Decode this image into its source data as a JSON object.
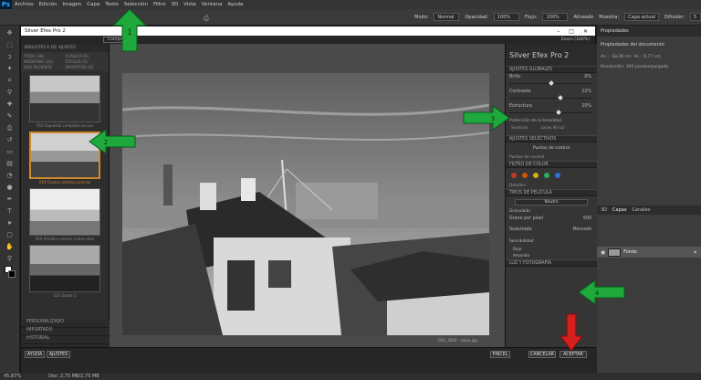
{
  "menubar": {
    "logo": "Ps",
    "items": [
      "Archivo",
      "Edición",
      "Imagen",
      "Capa",
      "Texto",
      "Selección",
      "Filtro",
      "3D",
      "Vista",
      "Ventana",
      "Ayuda"
    ]
  },
  "options": {
    "mode_label": "Modo:",
    "mode_value": "Normal",
    "opacity_label": "Opacidad:",
    "opacity_value": "100%",
    "flow_label": "Flujo:",
    "flow_value": "100%",
    "alineado": "Alineado",
    "muestra_label": "Muestra:",
    "muestra_value": "Capa actual",
    "difusion_label": "Difusión:",
    "difusion_value": "5"
  },
  "sefx": {
    "window_title": "Silver Efex Pro 2",
    "comparar": "Comparar",
    "zoom": "Zoom (100%)",
    "brand": "Silver Efex Pro 2",
    "categories": [
      "BIBLIOTECA DE AJUSTES",
      "TODO (38)",
      "CLÁSICO (9)",
      "MODERNO (10)",
      "ESTILOS (5)",
      "USO RECIENTE",
      "FAVORITOS (0)"
    ],
    "presets": [
      "016 Expuesto completo oscuro",
      "019 Trasero artístico preciso",
      "020 Artístico preciso (clave alta)",
      "021 Grabe 1"
    ],
    "bottom_cats": [
      "PERSONALIZADO",
      "IMPORTADO",
      "HISTORIAL"
    ],
    "global_header": "AJUSTES GLOBALES",
    "sliders": [
      {
        "label": "Brillo",
        "value": "0%"
      },
      {
        "label": "Contraste",
        "value": "22%"
      },
      {
        "label": "Estructura",
        "value": "20%"
      }
    ],
    "tonal": "Protección de la tonalidad",
    "sombras": "Sombras",
    "luces": "Luces de luz",
    "selective_header": "AJUSTES SELECTIVOS",
    "control_points": "Puntos de control",
    "control_points_sub": "Puntos de control",
    "color_filter": "FILTRO DE COLOR",
    "detalles": "Detalles",
    "film": "TIPOS DE PELÍCULA",
    "film_value": "Neutro",
    "granulado": "Granulado",
    "grano_label": "Grano por píxel",
    "grano_value": "500",
    "suavizado": "Suavizado",
    "mercado": "Mercado",
    "sensibilidad": "Sensibilidad",
    "rojo": "Rojo",
    "amarillo": "Amarillo",
    "curves": "LUZ Y FOTOGRAFÍA",
    "ayuda": "AYUDA",
    "ajustes": "AJUSTES",
    "pincel": "PINCEL",
    "cancelar": "CANCELAR",
    "aceptar": "ACEPTAR",
    "caption": "DSC_3600 - copia.jpg"
  },
  "props": {
    "tab": "Propiedades",
    "doc": "Propiedades del documento",
    "an_label": "An.:",
    "an_value": "18,36 cm",
    "al_label": "Al.:",
    "al_value": "6,77 cm",
    "res": "Resolución: 300 píxeles/pulgada"
  },
  "layers": {
    "tab1": "3D",
    "tab2": "Capas",
    "tab3": "Canales",
    "layer_name": "Fondo"
  },
  "status": {
    "zoom": "45,87%",
    "doc": "Doc: 2,75 MB/2,75 MB"
  },
  "steps": [
    "1",
    "2",
    "3",
    "4"
  ],
  "colors": {
    "green": "#1fa83b",
    "red": "#d62020",
    "orange": "#d08a2c"
  }
}
